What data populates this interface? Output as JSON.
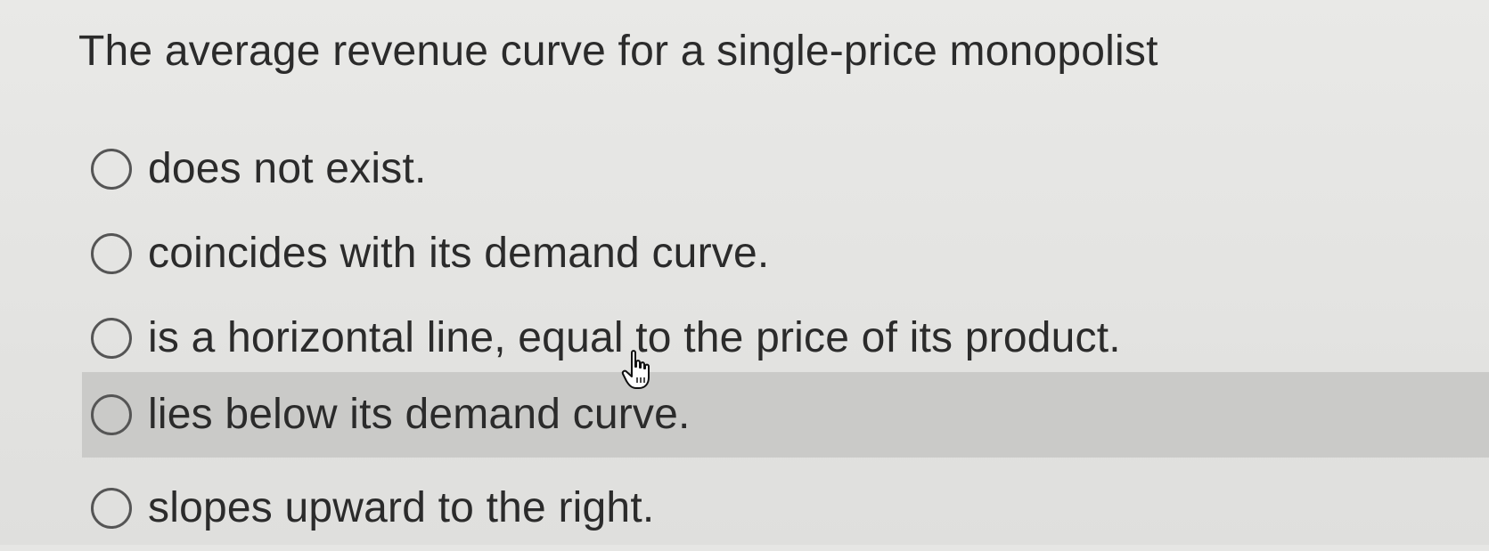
{
  "question": {
    "text": "The average revenue curve for a single-price monopolist"
  },
  "options": [
    {
      "label": "does not exist.",
      "selected": false
    },
    {
      "label": "coincides with its demand curve.",
      "selected": false
    },
    {
      "label": "is a horizontal line, equal to the price of its product.",
      "selected": false
    },
    {
      "label": "lies below its demand curve.",
      "selected": false,
      "hovered": true
    },
    {
      "label": "slopes upward to the right.",
      "selected": false
    }
  ],
  "cursor": {
    "icon": "hand-pointer-icon"
  },
  "colors": {
    "background": "#e6e6e4",
    "hover_highlight": "#cacac8",
    "text": "#2b2b2b",
    "radio_border": "#555555"
  }
}
